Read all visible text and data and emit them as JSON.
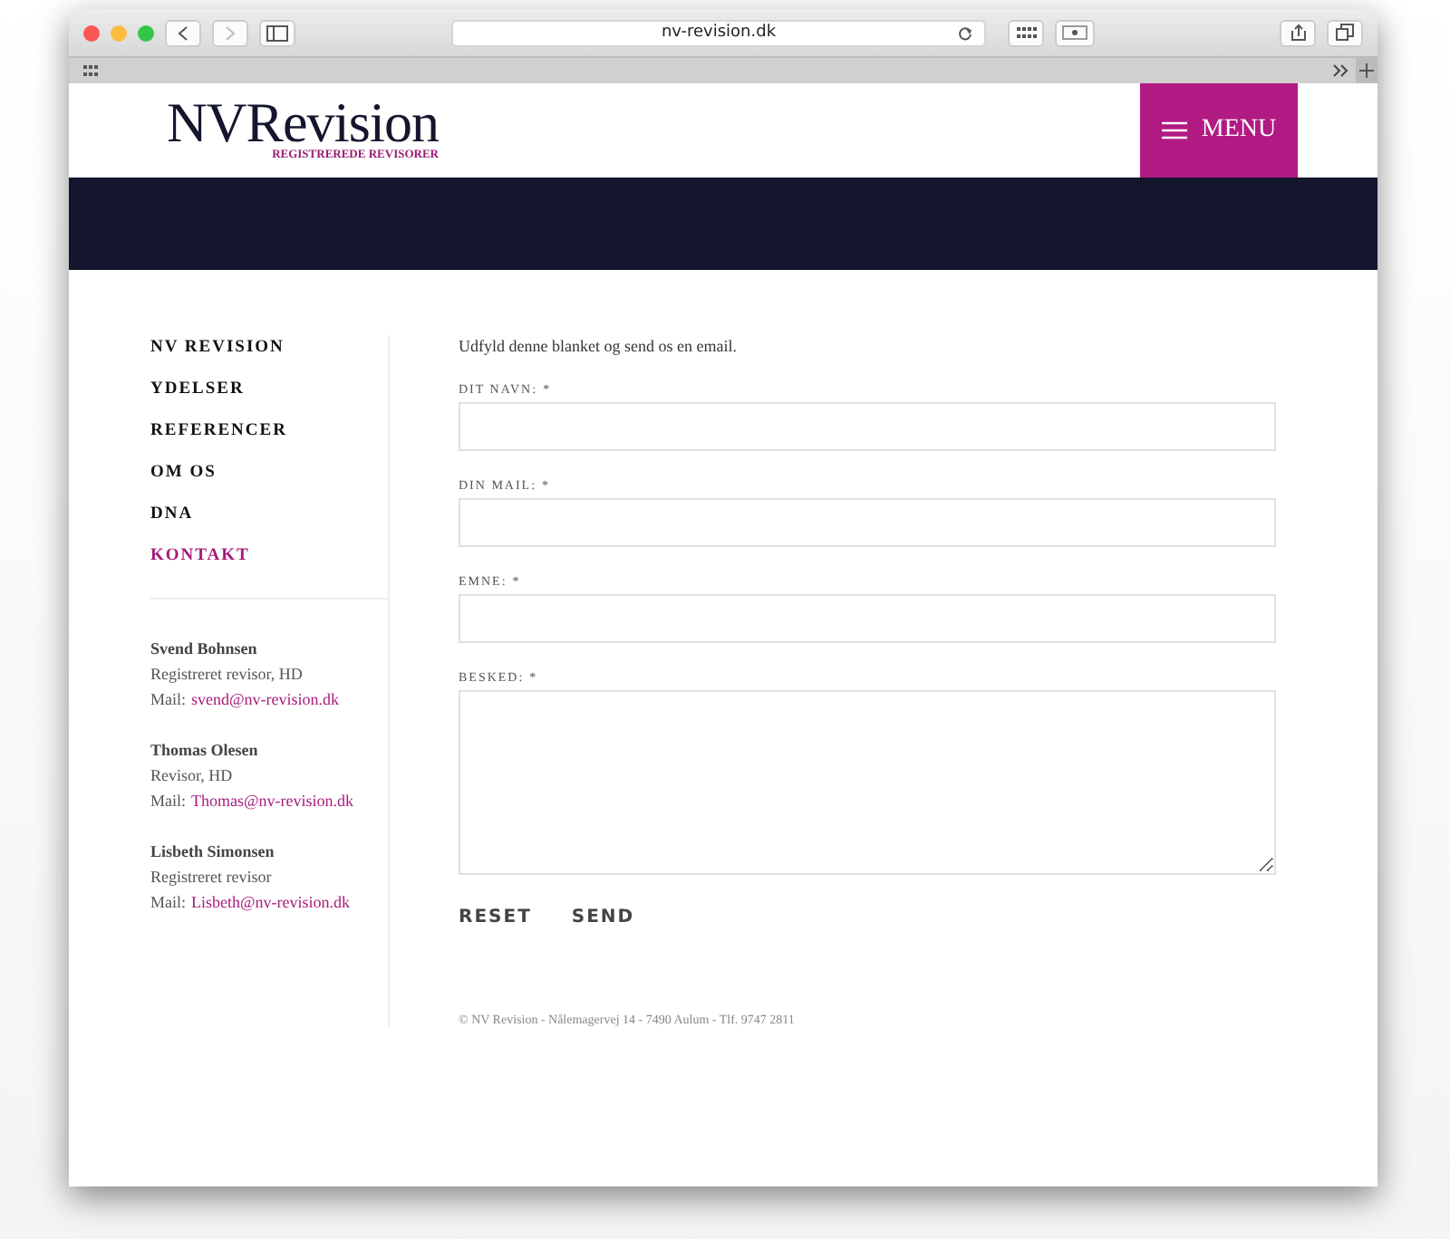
{
  "browser": {
    "url": "nv-revision.dk"
  },
  "header": {
    "logo": "NVRevision",
    "tagline": "REGISTREREDE REVISORER",
    "menu_button": "MENU"
  },
  "nav": [
    {
      "label": "NV REVISION",
      "selected": false
    },
    {
      "label": "YDELSER",
      "selected": false
    },
    {
      "label": "REFERENCER",
      "selected": false
    },
    {
      "label": "OM OS",
      "selected": false
    },
    {
      "label": "DNA",
      "selected": false
    },
    {
      "label": "KONTAKT",
      "selected": true
    }
  ],
  "contacts": [
    {
      "name": "Svend Bohnsen",
      "role": "Registreret revisor, HD",
      "mail_label": "Mail:",
      "mail": "svend@nv-revision.dk"
    },
    {
      "name": "Thomas Olesen",
      "role": "Revisor, HD",
      "mail_label": "Mail:",
      "mail": "Thomas@nv-revision.dk"
    },
    {
      "name": "Lisbeth Simonsen",
      "role": "Registreret revisor",
      "mail_label": "Mail:",
      "mail": "Lisbeth@nv-revision.dk"
    }
  ],
  "form": {
    "intro": "Udfyld denne blanket og send os en email.",
    "fields": [
      {
        "kind": "input",
        "label": "DIT NAVN:",
        "required": "*"
      },
      {
        "kind": "input",
        "label": "DIN MAIL:",
        "required": "*"
      },
      {
        "kind": "input",
        "label": "EMNE:",
        "required": "*"
      },
      {
        "kind": "textarea",
        "label": "BESKED:",
        "required": "*"
      }
    ],
    "buttons": [
      "RESET",
      "SEND"
    ]
  },
  "footer": "© NV Revision - Nålemagervej 14 - 7490 Aulum - Tlf. 9747 2811"
}
